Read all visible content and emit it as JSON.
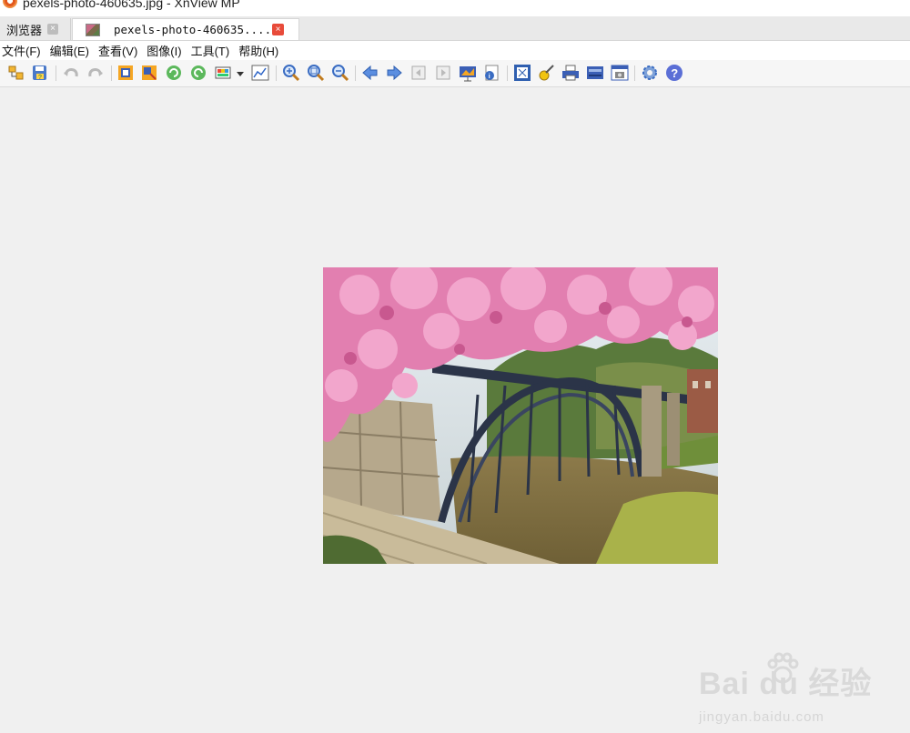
{
  "window": {
    "title": "pexels-photo-460635.jpg - XnView MP"
  },
  "tabs": [
    {
      "label": "浏览器",
      "close": "×"
    },
    {
      "label": "pexels-photo-460635....",
      "close": "×"
    }
  ],
  "menu": [
    "文件(F)",
    "编辑(E)",
    "查看(V)",
    "图像(I)",
    "工具(T)",
    "帮助(H)"
  ],
  "toolbar": {
    "icons": [
      "browser-icon",
      "save-icon",
      "undo-icon",
      "redo-icon",
      "crop-icon",
      "resize-icon",
      "rotate-left-icon",
      "rotate-right-icon",
      "color-adjust-icon",
      "dropdown-arrow-icon",
      "histogram-icon",
      "zoom-in-icon",
      "zoom-fit-icon",
      "zoom-out-icon",
      "previous-icon",
      "next-icon",
      "first-page-icon",
      "last-page-icon",
      "slideshow-icon",
      "info-icon",
      "fullscreen-icon",
      "edit-icon",
      "print-icon",
      "scanner-icon",
      "capture-icon",
      "settings-icon",
      "help-icon"
    ]
  },
  "image": {
    "name": "pexels-photo-460635.jpg",
    "alt": "cherry blossoms over iron bridge"
  },
  "watermark": {
    "brand": "Bai du 经验",
    "url": "jingyan.baidu.com"
  }
}
